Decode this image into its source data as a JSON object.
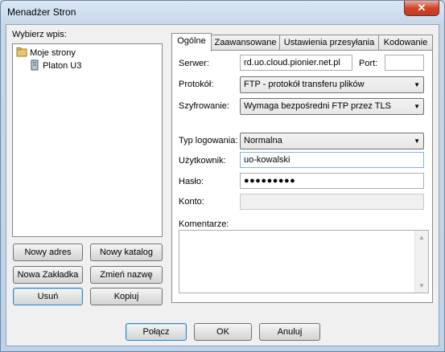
{
  "window": {
    "title": "Menadżer Stron",
    "close_glyph": "✕"
  },
  "left": {
    "select_label": "Wybierz wpis:",
    "tree": [
      {
        "label": "Moje strony",
        "icon": "folder-icon"
      },
      {
        "label": "Platon U3",
        "icon": "server-icon"
      }
    ],
    "buttons": {
      "new_address": "Nowy adres",
      "new_folder": "Nowy katalog",
      "new_bookmark": "Nowa Zakładka",
      "rename": "Zmień nazwę",
      "delete": "Usuń",
      "copy": "Kopiuj"
    }
  },
  "tabs": [
    "Ogólne",
    "Zaawansowane",
    "Ustawienia przesyłania",
    "Kodowanie"
  ],
  "general": {
    "server_label": "Serwer:",
    "server_value": "rd.uo.cloud.pionier.net.pl",
    "port_label": "Port:",
    "port_value": "",
    "protocol_label": "Protokół:",
    "protocol_value": "FTP - protokół transferu plików",
    "encryption_label": "Szyfrowanie:",
    "encryption_value": "Wymaga bezpośredni FTP przez TLS",
    "logon_type_label": "Typ logowania:",
    "logon_type_value": "Normalna",
    "user_label": "Użytkownik:",
    "user_value": "uo-kowalski",
    "password_label": "Hasło:",
    "password_value": "●●●●●●●●●",
    "account_label": "Konto:",
    "account_value": "",
    "comments_label": "Komentarze:",
    "comments_value": ""
  },
  "footer": {
    "connect": "Połącz",
    "ok": "OK",
    "cancel": "Anuluj"
  }
}
